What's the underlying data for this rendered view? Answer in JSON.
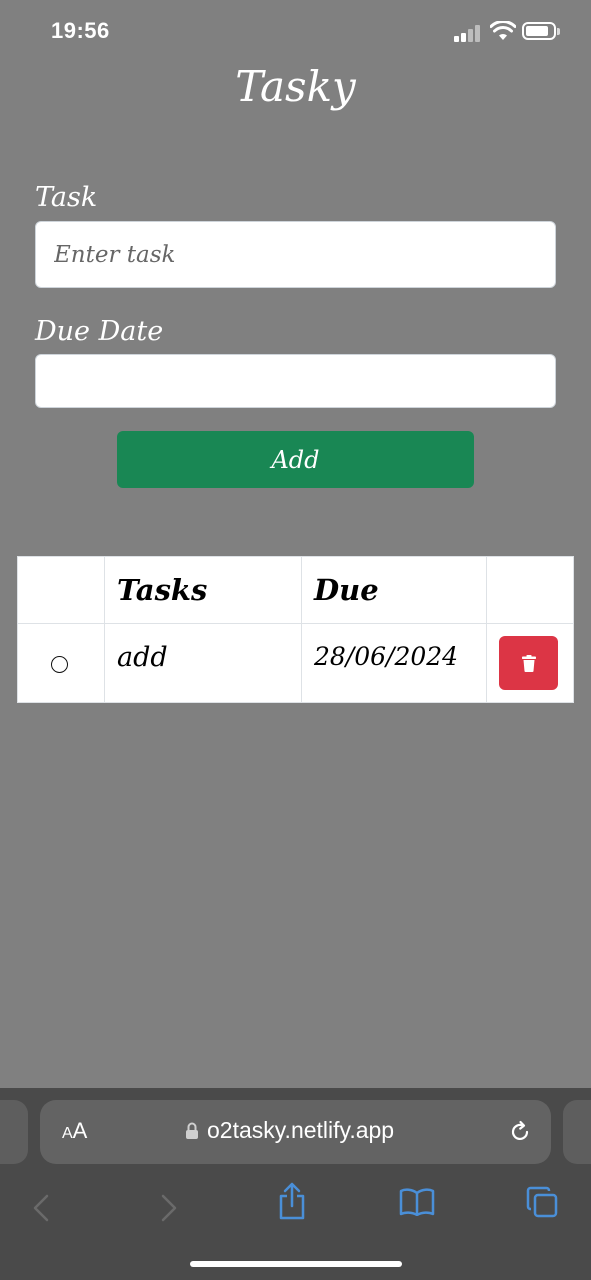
{
  "status_bar": {
    "time": "19:56"
  },
  "app": {
    "title": "Tasky"
  },
  "form": {
    "task_label": "Task",
    "task_placeholder": "Enter task",
    "task_value": "",
    "due_label": "Due Date",
    "due_value": "",
    "add_label": "Add"
  },
  "table": {
    "headers": [
      "",
      "Tasks",
      "Due",
      ""
    ],
    "rows": [
      {
        "done": false,
        "task": "add",
        "due": "28/06/2024"
      }
    ]
  },
  "browser": {
    "aa_small": "A",
    "aa_big": "A",
    "url": "o2tasky.netlify.app"
  },
  "colors": {
    "background": "#808080",
    "add_button": "#198754",
    "delete_button": "#dc3545",
    "toolbar_icon_active": "#4a8fd8",
    "toolbar_icon_disabled": "#6a6a6a"
  },
  "icons": [
    "cellular-signal-icon",
    "wifi-icon",
    "battery-icon",
    "trash-icon",
    "lock-icon",
    "reload-icon",
    "back-icon",
    "forward-icon",
    "share-icon",
    "bookmarks-icon",
    "tabs-icon"
  ]
}
